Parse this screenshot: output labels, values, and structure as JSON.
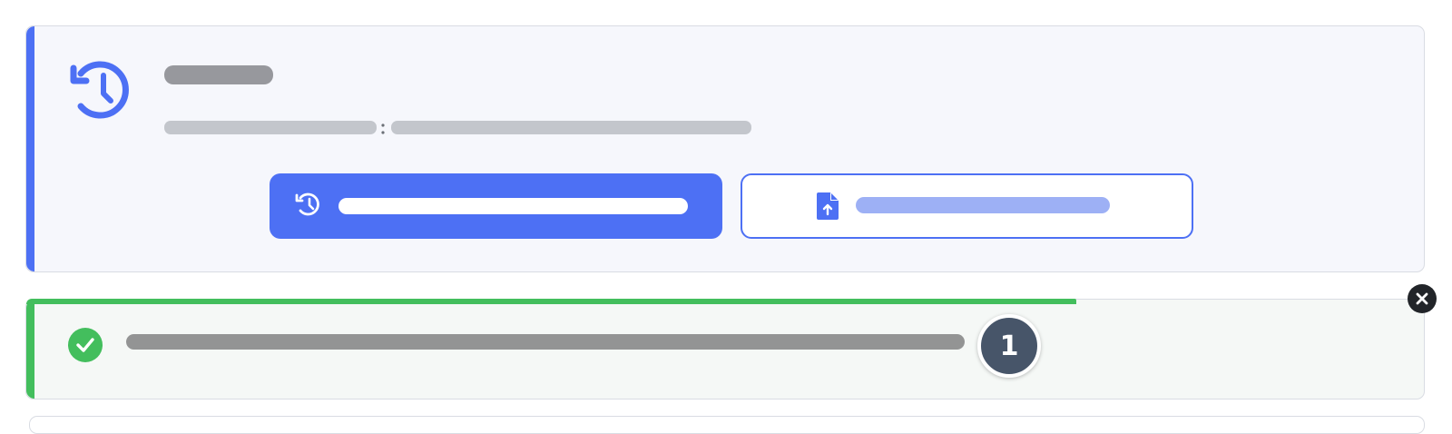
{
  "restore_card": {
    "icon": "history-icon",
    "accent_color": "#4d70f4",
    "title": "",
    "subtitle_left": "",
    "subtitle_separator": ":",
    "subtitle_right": "",
    "restore_button": {
      "icon": "history-icon",
      "label": ""
    },
    "upload_button": {
      "icon": "file-upload-icon",
      "label": ""
    }
  },
  "success_toast": {
    "icon": "check-circle-icon",
    "accent_color": "#43be5d",
    "message": "",
    "count": "1",
    "close_icon": "close-icon"
  }
}
